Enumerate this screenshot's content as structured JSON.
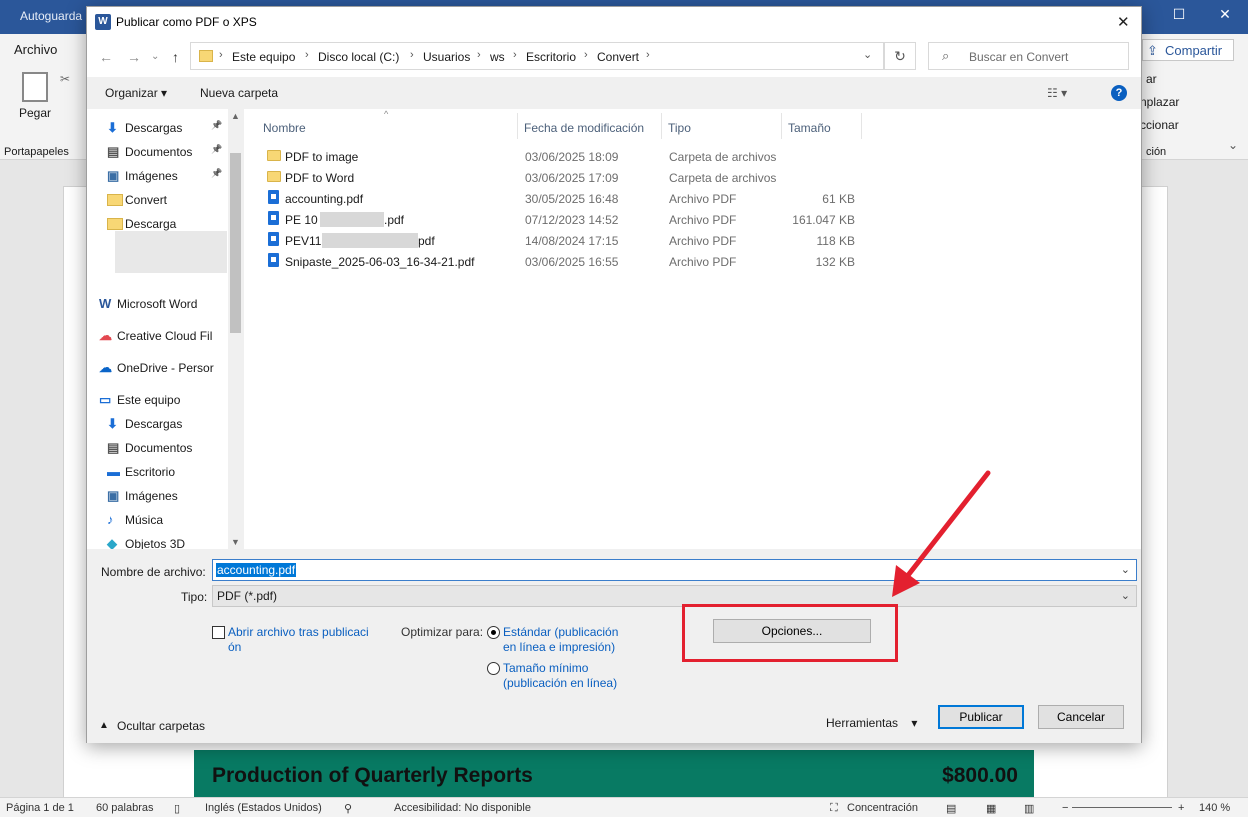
{
  "word": {
    "title": "Autoguarda",
    "archivo_tab": "Archivo",
    "share_button": "Compartir",
    "ribbon_paste": "Pegar",
    "ribbon_clipboard": "Portapapeles",
    "ribbon_right_items": [
      "ar",
      "nplazar",
      "ccionar",
      "ción"
    ],
    "banner_left": "Production of Quarterly Reports",
    "banner_right": "$800.00"
  },
  "status": {
    "page": "Página 1 de 1",
    "words": "60 palabras",
    "language": "Inglés (Estados Unidos)",
    "accessibility": "Accesibilidad: No disponible",
    "focus": "Concentración",
    "zoom": "140 %"
  },
  "dialog": {
    "title": "Publicar como PDF o XPS",
    "breadcrumbs": [
      "Este equipo",
      "Disco local (C:)",
      "Usuarios",
      "ws",
      "Escritorio",
      "Convert"
    ],
    "search_placeholder": "Buscar en Convert",
    "organize": "Organizar",
    "new_folder": "Nueva carpeta",
    "nav_items": [
      {
        "label": "Descargas",
        "icon": "download-icon",
        "pinned": true
      },
      {
        "label": "Documentos",
        "icon": "document-icon",
        "pinned": true
      },
      {
        "label": "Imágenes",
        "icon": "image-icon",
        "pinned": true
      },
      {
        "label": "Convert",
        "icon": "folder-icon",
        "pinned": false
      },
      {
        "label": "Descarga",
        "icon": "folder-icon",
        "pinned": false
      },
      {
        "label": "Microsoft Word",
        "icon": "word-icon",
        "pinned": false
      },
      {
        "label": "Creative Cloud Fil",
        "icon": "creative-cloud-icon",
        "pinned": false
      },
      {
        "label": "OneDrive - Persor",
        "icon": "onedrive-icon",
        "pinned": false
      },
      {
        "label": "Este equipo",
        "icon": "computer-icon",
        "pinned": false
      },
      {
        "label": "Descargas",
        "icon": "download-icon",
        "pinned": false
      },
      {
        "label": "Documentos",
        "icon": "document-icon",
        "pinned": false
      },
      {
        "label": "Escritorio",
        "icon": "desktop-icon",
        "pinned": false
      },
      {
        "label": "Imágenes",
        "icon": "image-icon",
        "pinned": false
      },
      {
        "label": "Música",
        "icon": "music-icon",
        "pinned": false
      },
      {
        "label": "Objetos 3D",
        "icon": "cube-icon",
        "pinned": false
      }
    ],
    "columns": [
      "Nombre",
      "Fecha de modificación",
      "Tipo",
      "Tamaño"
    ],
    "files": [
      {
        "name": "PDF to image",
        "date": "03/06/2025 18:09",
        "type": "Carpeta de archivos",
        "size": "",
        "kind": "folder"
      },
      {
        "name": "PDF to Word",
        "date": "03/06/2025 17:09",
        "type": "Carpeta de archivos",
        "size": "",
        "kind": "folder"
      },
      {
        "name": "accounting.pdf",
        "date": "30/05/2025 16:48",
        "type": "Archivo PDF",
        "size": "61 KB",
        "kind": "pdf"
      },
      {
        "name": "PE 10",
        "name_suffix": ".pdf",
        "date": "07/12/2023 14:52",
        "type": "Archivo PDF",
        "size": "161.047 KB",
        "kind": "pdf"
      },
      {
        "name": "PEV11",
        "name_suffix": "pdf",
        "date": "14/08/2024 17:15",
        "type": "Archivo PDF",
        "size": "118 KB",
        "kind": "pdf"
      },
      {
        "name": "Snipaste_2025-06-03_16-34-21.pdf",
        "date": "03/06/2025 16:55",
        "type": "Archivo PDF",
        "size": "132 KB",
        "kind": "pdf"
      }
    ],
    "filename_label": "Nombre de archivo:",
    "filename_value": "accounting.pdf",
    "type_label": "Tipo:",
    "type_value": "PDF (*.pdf)",
    "open_after_line1": "Abrir archivo tras publicaci",
    "open_after_line2": "ón",
    "optimize_label": "Optimizar para:",
    "opt_standard_line1": "Estándar (publicación",
    "opt_standard_line2": "en línea e impresión)",
    "opt_min_line1": "Tamaño mínimo",
    "opt_min_line2": "(publicación en línea)",
    "options_button": "Opciones...",
    "hide_folders": "Ocultar carpetas",
    "tools": "Herramientas",
    "publish_button": "Publicar",
    "cancel_button": "Cancelar"
  },
  "colors": {
    "word_blue": "#2b579a",
    "accent": "#0078d7",
    "banner": "#087a63",
    "highlight_box": "#e3202f"
  }
}
